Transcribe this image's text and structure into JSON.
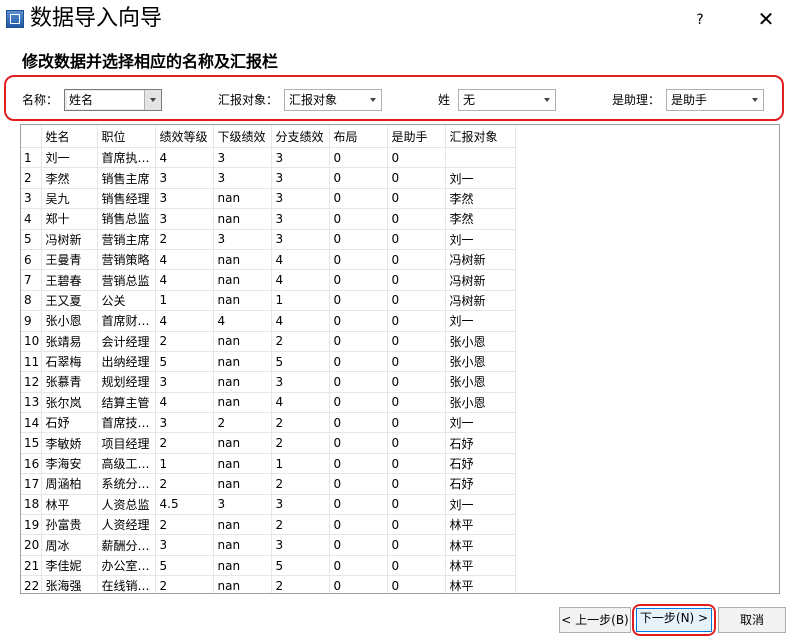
{
  "window": {
    "title": "数据导入向导",
    "help_label": "?",
    "close_label": "✕"
  },
  "subtitle": "修改数据并选择相应的名称及汇报栏",
  "filters": {
    "name": {
      "label": "名称：",
      "value": "姓名"
    },
    "report": {
      "label": "汇报对象：",
      "value": "汇报对象"
    },
    "surname": {
      "label": "姓",
      "value": "无"
    },
    "assistant": {
      "label": "是助理：",
      "value": "是助手"
    }
  },
  "table": {
    "headers": [
      "",
      "姓名",
      "职位",
      "绩效等级",
      "下级绩效",
      "分支绩效",
      "布局",
      "是助手",
      "汇报对象"
    ],
    "rows": [
      [
        "1",
        "刘一",
        "首席执…",
        "4",
        "3",
        "3",
        "0",
        "0",
        ""
      ],
      [
        "2",
        "李然",
        "销售主席",
        "3",
        "3",
        "3",
        "0",
        "0",
        "刘一"
      ],
      [
        "3",
        "吴九",
        "销售经理",
        "3",
        "nan",
        "3",
        "0",
        "0",
        "李然"
      ],
      [
        "4",
        "郑十",
        "销售总监",
        "3",
        "nan",
        "3",
        "0",
        "0",
        "李然"
      ],
      [
        "5",
        "冯树新",
        "营销主席",
        "2",
        "3",
        "3",
        "0",
        "0",
        "刘一"
      ],
      [
        "6",
        "王曼青",
        "营销策略",
        "4",
        "nan",
        "4",
        "0",
        "0",
        "冯树新"
      ],
      [
        "7",
        "王碧春",
        "营销总监",
        "4",
        "nan",
        "4",
        "0",
        "0",
        "冯树新"
      ],
      [
        "8",
        "王又夏",
        "公关",
        "1",
        "nan",
        "1",
        "0",
        "0",
        "冯树新"
      ],
      [
        "9",
        "张小恩",
        "首席财…",
        "4",
        "4",
        "4",
        "0",
        "0",
        "刘一"
      ],
      [
        "10",
        "张靖易",
        "会计经理",
        "2",
        "nan",
        "2",
        "0",
        "0",
        "张小恩"
      ],
      [
        "11",
        "石翠梅",
        "出纳经理",
        "5",
        "nan",
        "5",
        "0",
        "0",
        "张小恩"
      ],
      [
        "12",
        "张慕青",
        "规划经理",
        "3",
        "nan",
        "3",
        "0",
        "0",
        "张小恩"
      ],
      [
        "13",
        "张尔岚",
        "结算主管",
        "4",
        "nan",
        "4",
        "0",
        "0",
        "张小恩"
      ],
      [
        "14",
        "石妤",
        "首席技…",
        "3",
        "2",
        "2",
        "0",
        "0",
        "刘一"
      ],
      [
        "15",
        "李敏娇",
        "项目经理",
        "2",
        "nan",
        "2",
        "0",
        "0",
        "石妤"
      ],
      [
        "16",
        "李海安",
        "高级工…",
        "1",
        "nan",
        "1",
        "0",
        "0",
        "石妤"
      ],
      [
        "17",
        "周涵柏",
        "系统分…",
        "2",
        "nan",
        "2",
        "0",
        "0",
        "石妤"
      ],
      [
        "18",
        "林平",
        "人资总监",
        "4.5",
        "3",
        "3",
        "0",
        "0",
        "刘一"
      ],
      [
        "19",
        "孙富贵",
        "人资经理",
        "2",
        "nan",
        "2",
        "0",
        "0",
        "林平"
      ],
      [
        "20",
        "周冰",
        "薪酬分…",
        "3",
        "nan",
        "3",
        "0",
        "0",
        "林平"
      ],
      [
        "21",
        "李佳妮",
        "办公室…",
        "5",
        "nan",
        "5",
        "0",
        "0",
        "林平"
      ],
      [
        "22",
        "张海强",
        "在线销…",
        "2",
        "nan",
        "2",
        "0",
        "0",
        "林平"
      ]
    ]
  },
  "buttons": {
    "prev": "< 上一步(B)",
    "next": "下一步(N) >",
    "cancel": "取消"
  }
}
